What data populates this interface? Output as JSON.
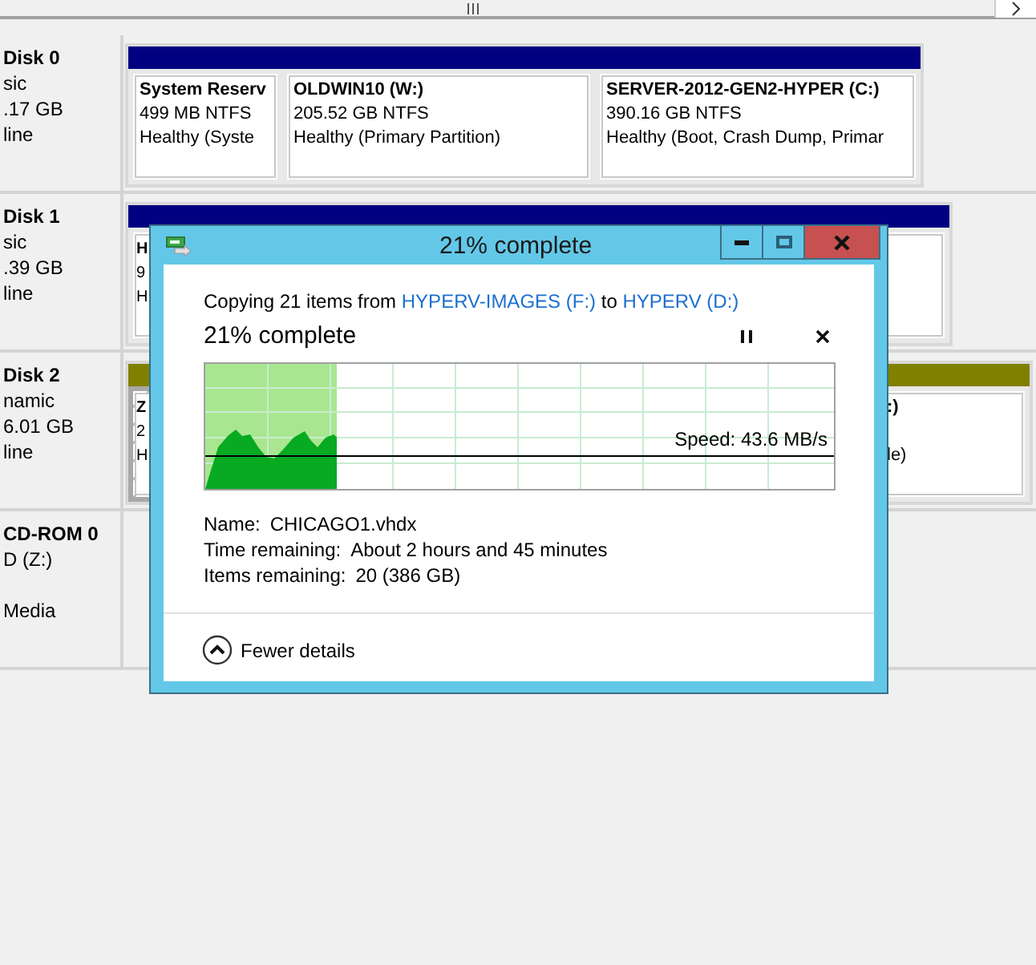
{
  "disks": [
    {
      "kind": "disk",
      "label": "Disk 0",
      "lines": [
        "sic",
        ".17 GB",
        "line"
      ],
      "color": "#000080",
      "partitions": [
        {
          "title": "System Reserv",
          "lines": [
            "499 MB NTFS",
            "Healthy (Syste"
          ],
          "hatched": false
        },
        {
          "title": "OLDWIN10  (W:)",
          "lines": [
            "205.52 GB NTFS",
            "Healthy (Primary Partition)"
          ],
          "hatched": false
        },
        {
          "title": "SERVER-2012-GEN2-HYPER  (C:)",
          "lines": [
            "390.16 GB NTFS",
            "Healthy (Boot, Crash Dump, Primar"
          ],
          "hatched": false
        }
      ]
    },
    {
      "kind": "disk",
      "label": "Disk 1",
      "lines": [
        "sic",
        ".39 GB",
        "line"
      ],
      "color": "#000080",
      "partitions": [
        {
          "title": "H",
          "lines": [
            "9",
            "H"
          ],
          "hatched": false
        }
      ]
    },
    {
      "kind": "disk",
      "label": "Disk 2",
      "lines": [
        "namic",
        "6.01 GB",
        "line"
      ],
      "color": "#808000",
      "partitions": [
        {
          "title": "Z",
          "lines": [
            "2",
            "H"
          ],
          "hatched": true
        },
        {
          "title": ":)",
          "lines": [
            "le)"
          ],
          "hatched": false
        }
      ]
    },
    {
      "kind": "cdrom",
      "label": "CD-ROM 0",
      "lines": [
        "D (Z:)",
        "Media"
      ]
    }
  ],
  "dialog": {
    "title": "21% complete",
    "copying": {
      "prefix": "Copying 21 items from ",
      "source": "HYPERV-IMAGES (F:)",
      "middle": " to ",
      "dest": "HYPERV (D:)"
    },
    "heading": "21% complete",
    "level": 0.21,
    "speed": "Speed: 43.6 MB/s",
    "details": [
      {
        "label": "Name:",
        "value": "CHICAGO1.vhdx"
      },
      {
        "label": "Time remaining:",
        "value": "About 2 hours and 45 minutes"
      },
      {
        "label": "Items remaining:",
        "value": "20 (386 GB)"
      }
    ],
    "toggle": "Fewer details"
  }
}
